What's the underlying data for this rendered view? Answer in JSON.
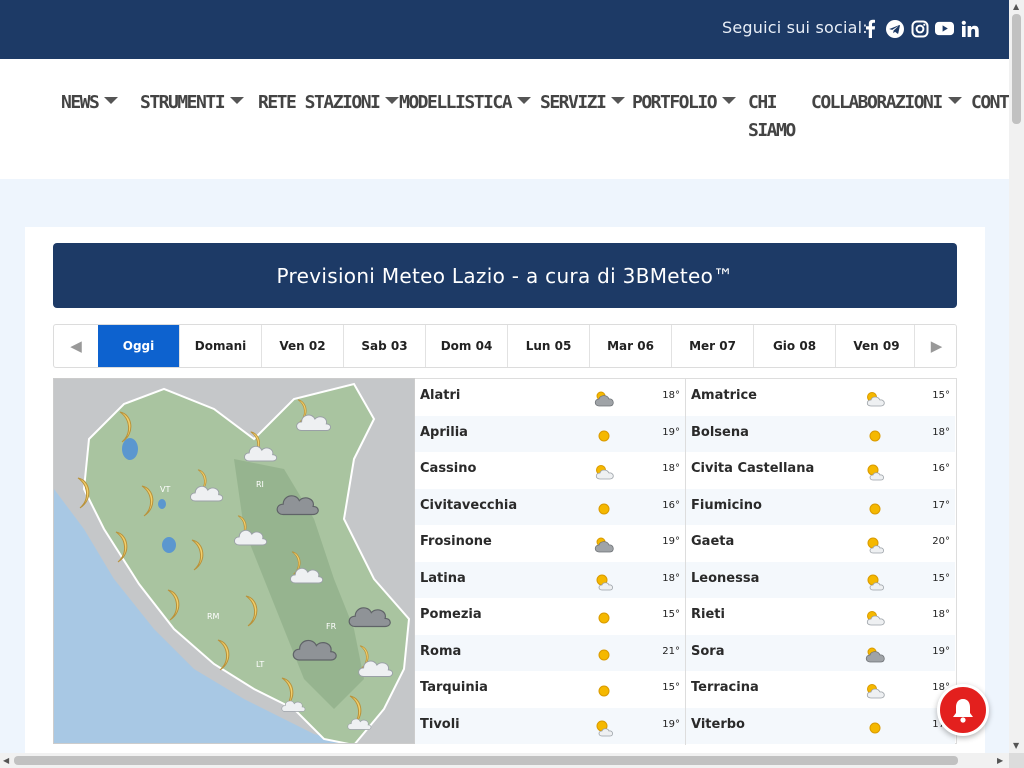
{
  "social": {
    "label": "Seguici sui social:",
    "icons": [
      "facebook-icon",
      "telegram-icon",
      "instagram-icon",
      "youtube-icon",
      "linkedin-icon"
    ]
  },
  "nav": {
    "items": [
      {
        "label": "NEWS"
      },
      {
        "label": "STRUMENTI"
      },
      {
        "label": "RETE STAZIONI"
      },
      {
        "label": "MODELLISTICA"
      },
      {
        "label": "SERVIZI"
      },
      {
        "label": "PORTFOLIO"
      },
      {
        "label_line1": "CHI",
        "label_line2": "SIAMO"
      },
      {
        "label": "COLLABORAZIONI"
      },
      {
        "label": "CONT"
      }
    ]
  },
  "header": {
    "title": "Previsioni Meteo Lazio - a cura di 3BMeteo™"
  },
  "tabs": {
    "prev_icon": "◀",
    "next_icon": "▶",
    "days": [
      "Oggi",
      "Domani",
      "Ven 02",
      "Sab 03",
      "Dom 04",
      "Lun 05",
      "Mar 06",
      "Mer 07",
      "Gio 08",
      "Ven 09"
    ],
    "active_index": 0
  },
  "map": {
    "province_labels": [
      "VT",
      "RI",
      "RM",
      "FR",
      "LT"
    ]
  },
  "forecast": {
    "left": [
      {
        "city": "Alatri",
        "icon": "cloudy",
        "temp": "18°"
      },
      {
        "city": "Aprilia",
        "icon": "sun",
        "temp": "19°"
      },
      {
        "city": "Cassino",
        "icon": "partly-cloudy",
        "temp": "18°"
      },
      {
        "city": "Civitavecchia",
        "icon": "sun",
        "temp": "16°"
      },
      {
        "city": "Frosinone",
        "icon": "cloudy",
        "temp": "19°"
      },
      {
        "city": "Latina",
        "icon": "sun-cloud",
        "temp": "18°"
      },
      {
        "city": "Pomezia",
        "icon": "sun",
        "temp": "15°"
      },
      {
        "city": "Roma",
        "icon": "sun",
        "temp": "21°"
      },
      {
        "city": "Tarquinia",
        "icon": "sun",
        "temp": "15°"
      },
      {
        "city": "Tivoli",
        "icon": "sun-cloud",
        "temp": "19°"
      }
    ],
    "right": [
      {
        "city": "Amatrice",
        "icon": "partly-cloudy",
        "temp": "15°"
      },
      {
        "city": "Bolsena",
        "icon": "sun",
        "temp": "18°"
      },
      {
        "city": "Civita Castellana",
        "icon": "sun-cloud",
        "temp": "16°"
      },
      {
        "city": "Fiumicino",
        "icon": "sun",
        "temp": "17°"
      },
      {
        "city": "Gaeta",
        "icon": "sun-cloud",
        "temp": "20°"
      },
      {
        "city": "Leonessa",
        "icon": "sun-cloud",
        "temp": "15°"
      },
      {
        "city": "Rieti",
        "icon": "partly-cloudy",
        "temp": "18°"
      },
      {
        "city": "Sora",
        "icon": "cloudy",
        "temp": "19°"
      },
      {
        "city": "Terracina",
        "icon": "partly-cloudy",
        "temp": "18°"
      },
      {
        "city": "Viterbo",
        "icon": "sun",
        "temp": "17°"
      }
    ]
  },
  "notification": {
    "icon": "bell-icon"
  },
  "colors": {
    "navy": "#1d3a66",
    "tab_active": "#0d62cf",
    "sun": "#f5b800",
    "bell": "#e3201e"
  }
}
